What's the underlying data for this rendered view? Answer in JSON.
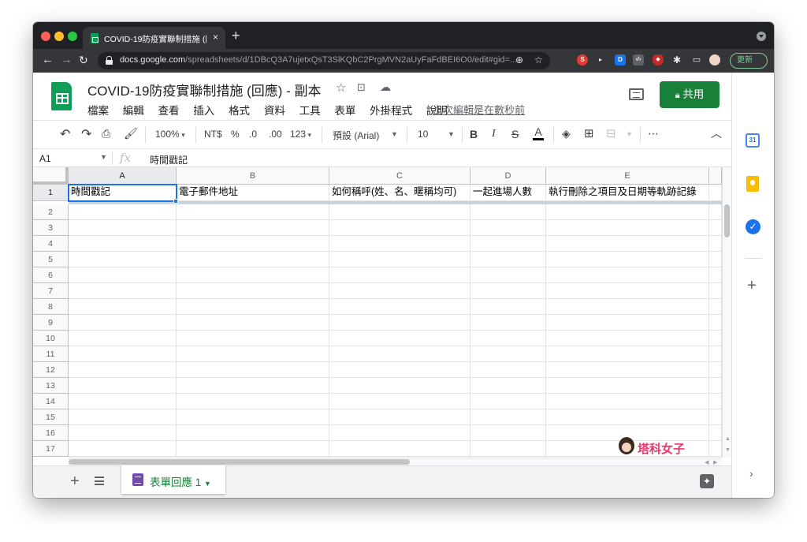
{
  "browser": {
    "tab_title": "COVID-19防疫實聯制措施 (回應",
    "tab_close": "×",
    "new_tab": "+",
    "url_domain": "docs.google.com",
    "url_path": "/spreadsheets/d/1DBcQ3A7ujetxQsT3SlKQbC2PrgMVN2aUyFaFdBEI6O0/edit#gid=...",
    "update_label": "更新",
    "extensions": [
      {
        "name": "s-extension",
        "label": "S",
        "color": "#e53935"
      },
      {
        "name": "d-extension",
        "label": "D",
        "color": "#1a73e8"
      },
      {
        "name": "code-extension",
        "label": "‹/›",
        "color": "#5f6368"
      },
      {
        "name": "shield-extension",
        "label": "◆",
        "color": "#e53935"
      }
    ]
  },
  "header": {
    "doc_title": "COVID-19防疫實聯制措施 (回應) - 副本",
    "menu": [
      "檔案",
      "編輯",
      "查看",
      "插入",
      "格式",
      "資料",
      "工具",
      "表單",
      "外掛程式",
      "說明"
    ],
    "last_edit": "上次編輯是在數秒前",
    "share_label": "共用",
    "share_icon": "lock-icon"
  },
  "toolbar": {
    "zoom": "100%",
    "currency": "NT$",
    "percent": "%",
    "decrease_decimal": ".0",
    "increase_decimal": ".00",
    "number_format": "123",
    "font": "預設 (Arial)",
    "font_size": "10",
    "bold": "B",
    "italic": "I",
    "strike": "S",
    "text_color": "A",
    "more": "⋯",
    "collapse": "︿"
  },
  "formula_bar": {
    "cell_ref": "A1",
    "fx": "fx",
    "content": "時間戳記"
  },
  "grid": {
    "columns": [
      "A",
      "B",
      "C",
      "D",
      "E"
    ],
    "rows": [
      "1",
      "2",
      "3",
      "4",
      "5",
      "6",
      "7",
      "8",
      "9",
      "10",
      "11",
      "12",
      "13",
      "14",
      "15",
      "16",
      "17"
    ],
    "header_row": [
      "時間戳記",
      "電子郵件地址",
      "如何稱呼(姓、名、暱稱均可)",
      "一起進場人數",
      "執行刪除之項目及日期等軌跡記錄"
    ]
  },
  "sheets": {
    "add": "+",
    "active_sheet": "表單回應 1"
  },
  "side_panel": {
    "calendar_label": "31",
    "tasks_label": "✓",
    "add": "+",
    "expand": "›"
  },
  "watermark": "塔科女子"
}
